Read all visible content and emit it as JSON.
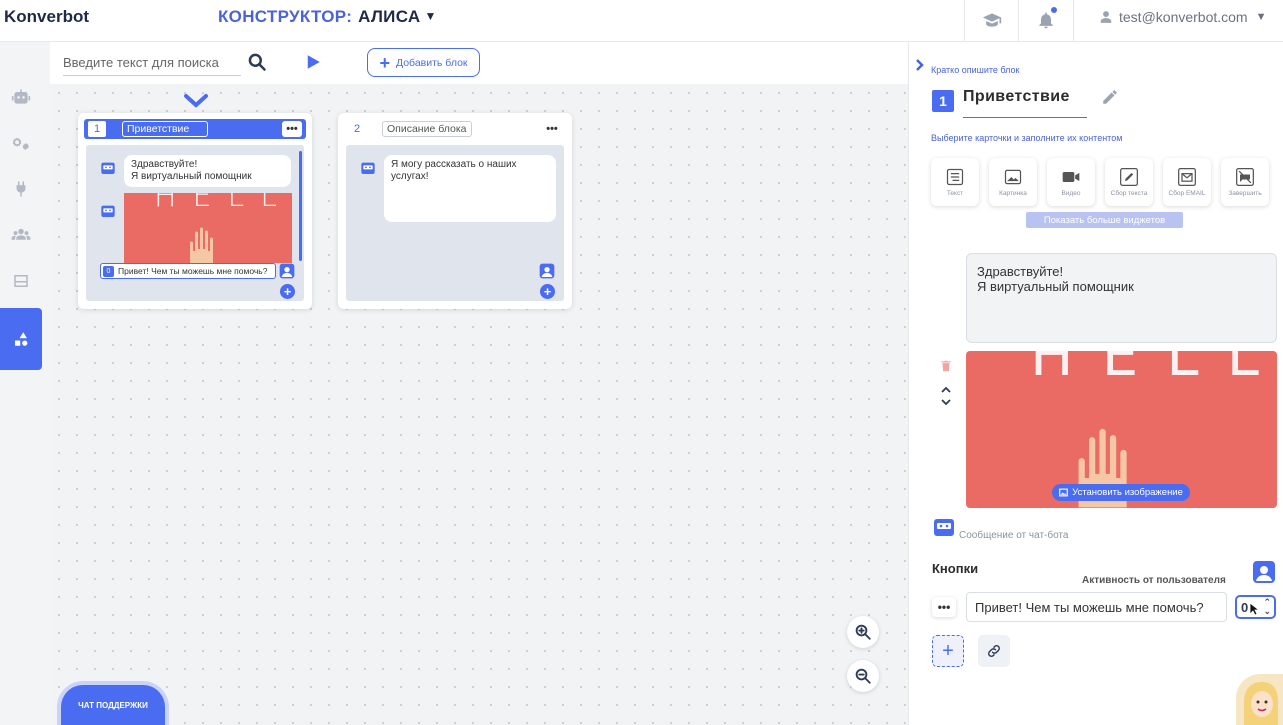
{
  "app": {
    "logo": "Konverbot",
    "constructor_label": "КОНСТРУКТОР:",
    "bot_name": "АЛИСА",
    "user_email": "test@konverbot.com"
  },
  "toolbar": {
    "search_placeholder": "Введите текст для поиска",
    "add_block_label": "Добавить блок"
  },
  "canvas": {
    "blocks": [
      {
        "number": "1",
        "name": "Приветствие",
        "bot_message": "Здравствуйте!\nЯ виртуальный помощник",
        "image_text": "HELLO",
        "button_index": "0",
        "button_text": "Привет! Чем ты можешь мне помочь?"
      },
      {
        "number": "2",
        "name": "Описание блока",
        "bot_message": "Я могу рассказать о наших услугах!"
      }
    ],
    "support_label": "ЧАТ ПОДДЕРЖКИ"
  },
  "panel": {
    "hint_label": "Кратко опишите блок",
    "block_number": "1",
    "block_title": "Приветствие",
    "cards_hint": "Выберите карточки и заполните их контентом",
    "widgets": [
      {
        "label": "Текст",
        "icon": "text-icon"
      },
      {
        "label": "Картинка",
        "icon": "image-icon"
      },
      {
        "label": "Видео",
        "icon": "video-icon"
      },
      {
        "label": "Сбор текста",
        "icon": "pencil-icon"
      },
      {
        "label": "Сбор EMAIL",
        "icon": "mail-icon"
      },
      {
        "label": "Завершить",
        "icon": "end-icon"
      }
    ],
    "more_widgets_label": "Показать больше виджетов",
    "message_text": "Здравствуйте!\nЯ виртуальный помощник",
    "image_text": "HELLO",
    "set_image_label": "Установить изображение",
    "bot_message_caption": "Сообщение от чат-бота",
    "buttons_title": "Кнопки",
    "user_activity_label": "Активность от пользователя",
    "button_value": "Привет! Чем ты можешь мне помочь?",
    "stepper_value": "0"
  },
  "colors": {
    "accent": "#4a6cf0",
    "image_bg": "#ea6a64"
  }
}
